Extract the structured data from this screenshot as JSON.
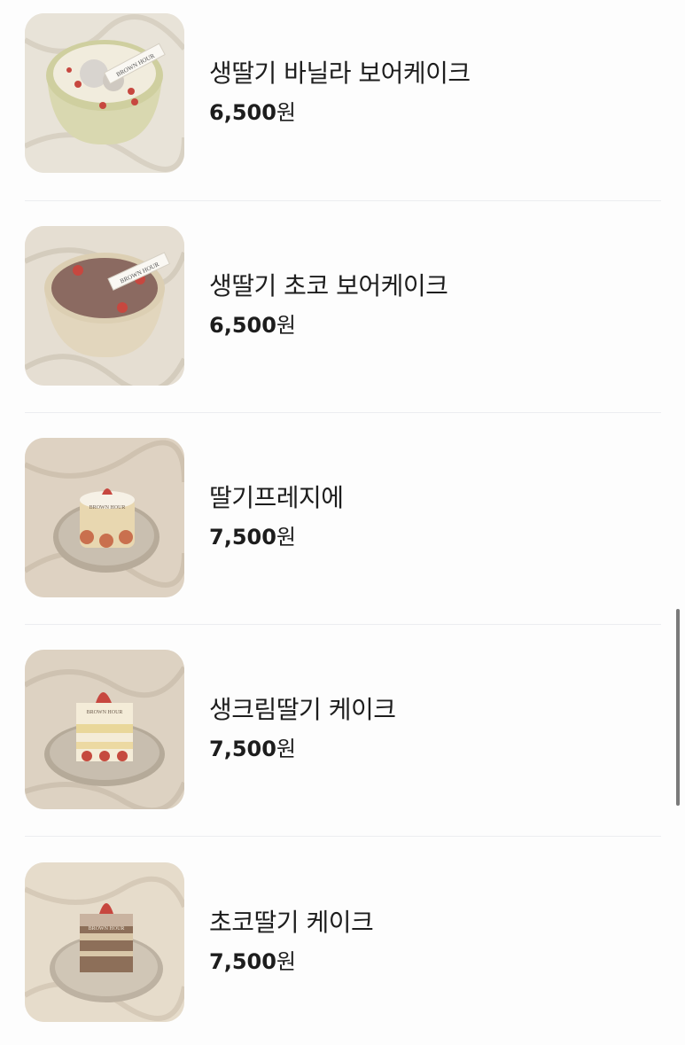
{
  "products": [
    {
      "name": "생딸기 바닐라 보어케이크",
      "price": "6,500",
      "currency": "원",
      "image": "vanilla-bowl-cake"
    },
    {
      "name": "생딸기 초코 보어케이크",
      "price": "6,500",
      "currency": "원",
      "image": "choco-bowl-cake"
    },
    {
      "name": "딸기프레지에",
      "price": "7,500",
      "currency": "원",
      "image": "fraisier-cake"
    },
    {
      "name": "생크림딸기 케이크",
      "price": "7,500",
      "currency": "원",
      "image": "cream-strawberry-cake"
    },
    {
      "name": "초코딸기 케이크",
      "price": "7,500",
      "currency": "원",
      "image": "choco-strawberry-cake"
    }
  ],
  "brand_label": "BROWN HOUR"
}
